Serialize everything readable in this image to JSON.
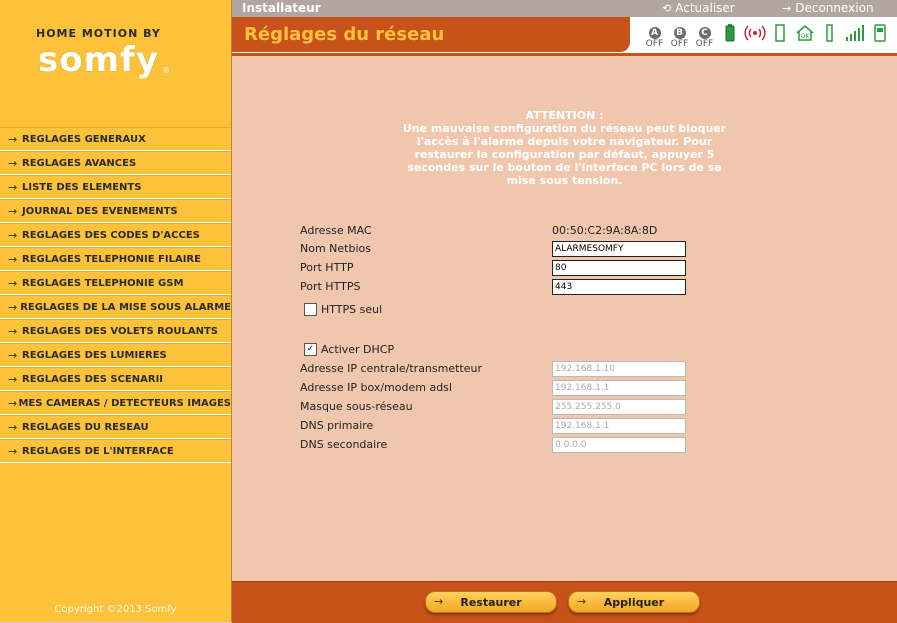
{
  "brand": {
    "top": "HOME MOTION BY",
    "main": "somfy",
    "reg": "®"
  },
  "menu": [
    {
      "label": "REGLAGES GENERAUX"
    },
    {
      "label": "REGLAGES AVANCES"
    },
    {
      "label": "LISTE DES ELEMENTS"
    },
    {
      "label": "JOURNAL DES EVENEMENTS"
    },
    {
      "label": "REGLAGES DES CODES D'ACCES"
    },
    {
      "label": "REGLAGES TELEPHONIE FILAIRE"
    },
    {
      "label": "REGLAGES TELEPHONIE GSM"
    },
    {
      "label": "REGLAGES DE LA MISE SOUS ALARME"
    },
    {
      "label": "REGLAGES DES VOLETS ROULANTS"
    },
    {
      "label": "REGLAGES DES LUMIERES"
    },
    {
      "label": "REGLAGES DES SCENARII"
    },
    {
      "label": "MES CAMERAS / DETECTEURS IMAGES"
    },
    {
      "label": "REGLAGES DU RESEAU"
    },
    {
      "label": "REGLAGES DE L'INTERFACE"
    }
  ],
  "copyright": "Copyright ©2013 Somfy",
  "topbar": {
    "role": "Installateur",
    "refresh": "Actualiser",
    "logout": "Deconnexion"
  },
  "header": {
    "title": "Réglages du réseau"
  },
  "status": {
    "zones": [
      {
        "badge": "A",
        "state": "OFF"
      },
      {
        "badge": "B",
        "state": "OFF"
      },
      {
        "badge": "C",
        "state": "OFF"
      }
    ],
    "icons": [
      "battery-icon",
      "radio-signal-icon",
      "door-icon",
      "home-ok-icon",
      "sensor-icon",
      "signal-bars-icon",
      "device-icon"
    ],
    "colors": {
      "green": "#2e9a3c",
      "grey": "#6b6b6b"
    }
  },
  "warning": {
    "title": "ATTENTION :",
    "text": "Une mauvaise configuration du réseau peut bloquer l'accès à l'alarme depuis votre navigateur. Pour restaurer la configuration par défaut, appuyer 5 secondes sur le bouton de l'interface PC lors de sa mise sous tension."
  },
  "network": {
    "mac_label": "Adresse MAC",
    "mac_value": "00:50:C2:9A:8A:8D",
    "netbios_label": "Nom Netbios",
    "netbios_value": "ALARMESOMFY",
    "http_label": "Port HTTP",
    "http_value": "80",
    "https_label": "Port HTTPS",
    "https_value": "443",
    "https_only_label": "HTTPS seul",
    "https_only_checked": false,
    "dhcp_label": "Activer DHCP",
    "dhcp_checked": true,
    "ip_label": "Adresse IP centrale/transmetteur",
    "ip_value": "192.168.1.10",
    "box_label": "Adresse IP box/modem adsl",
    "box_value": "192.168.1.1",
    "mask_label": "Masque sous-réseau",
    "mask_value": "255.255.255.0",
    "dns1_label": "DNS primaire",
    "dns1_value": "192.168.1.1",
    "dns2_label": "DNS secondaire",
    "dns2_value": "0.0.0.0"
  },
  "buttons": {
    "restore": "Restaurer",
    "apply": "Appliquer"
  },
  "colors": {
    "sidebar": "#fbc23a",
    "accent": "#c9511a",
    "content_bg": "#f0c7ad",
    "title_text": "#fbc23a"
  }
}
